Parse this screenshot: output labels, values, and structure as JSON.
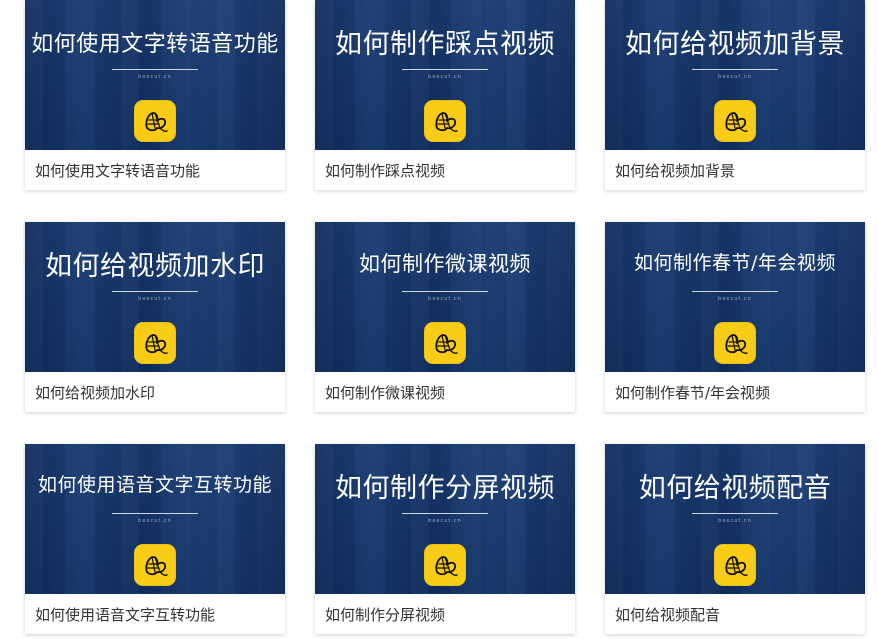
{
  "items": [
    {
      "thumbnail_title": "如何使用文字转语音功能",
      "site": "beecut.cn",
      "caption": "如何使用文字转语音功能"
    },
    {
      "thumbnail_title": "如何制作踩点视频",
      "site": "beecut.cn",
      "caption": "如何制作踩点视频"
    },
    {
      "thumbnail_title": "如何给视频加背景",
      "site": "beecut.cn",
      "caption": "如何给视频加背景"
    },
    {
      "thumbnail_title": "如何给视频加水印",
      "site": "beecut.cn",
      "caption": "如何给视频加水印"
    },
    {
      "thumbnail_title": "如何制作微课视频",
      "site": "beecut.cn",
      "caption": "如何制作微课视频"
    },
    {
      "thumbnail_title": "如何制作春节/年会视频",
      "site": "beecut.cn",
      "caption": "如何制作春节/年会视频"
    },
    {
      "thumbnail_title": "如何使用语音文字互转功能",
      "site": "beecut.cn",
      "caption": "如何使用语音文字互转功能"
    },
    {
      "thumbnail_title": "如何制作分屏视频",
      "site": "beecut.cn",
      "caption": "如何制作分屏视频"
    },
    {
      "thumbnail_title": "如何给视频配音",
      "site": "beecut.cn",
      "caption": "如何给视频配音"
    }
  ],
  "colors": {
    "thumbnail_background": "#173a72",
    "logo_yellow": "#f8cb16",
    "caption_text": "#333333"
  },
  "icons": {
    "logo": "bee-logo-icon"
  }
}
